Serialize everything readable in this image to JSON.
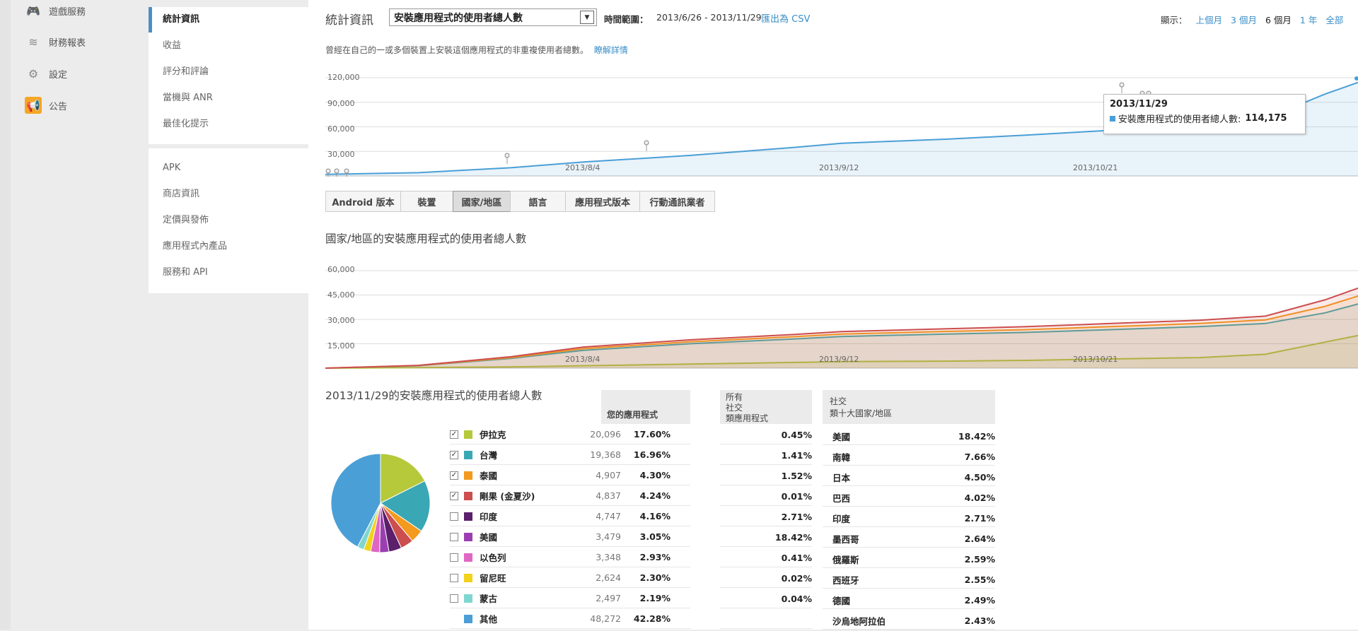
{
  "left_nav": {
    "items": [
      {
        "label": "遊戲服務",
        "icon": "gamepad-icon"
      },
      {
        "label": "財務報表",
        "icon": "coins-icon"
      },
      {
        "label": "設定",
        "icon": "gear-icon"
      },
      {
        "label": "公告",
        "icon": "megaphone-icon"
      }
    ]
  },
  "sub_nav": {
    "group1": [
      "統計資訊",
      "收益",
      "評分和評論",
      "當機與 ANR",
      "最佳化提示"
    ],
    "group2": [
      "APK",
      "商店資訊",
      "定價與發佈",
      "應用程式內產品",
      "服務和 API"
    ]
  },
  "header": {
    "section": "統計資訊",
    "metric_select": "安裝應用程式的使用者總人數",
    "range_label": "時間範圍：",
    "range_value": "2013/6/26 - 2013/11/29",
    "export": "匯出為 CSV",
    "show_label": "顯示：",
    "periods": [
      "上個月",
      "3 個月",
      "6 個月",
      "1 年",
      "全部"
    ],
    "active_period": "6 個月",
    "description": "曾經在自己的一或多個裝置上安裝這個應用程式的非重複使用者總數。",
    "learn_more": "瞭解詳情"
  },
  "colors": {
    "accent": "#3a8ec8",
    "series_total": "#4a9fd6",
    "iraq": "#b5c93a",
    "taiwan": "#3aa7b5",
    "thailand": "#f39a1f",
    "congo": "#cc4e4e",
    "india": "#5b1f6b",
    "usa": "#9b3fb0",
    "israel": "#e066c4",
    "reunion": "#f2d21a",
    "mongolia": "#7fd6d0",
    "other": "#4a9fd6"
  },
  "chart_data": [
    {
      "type": "area",
      "title": "",
      "y_ticks": [
        "120,000",
        "90,000",
        "60,000",
        "30,000"
      ],
      "x_ticks": [
        "2013/8/4",
        "2013/9/12",
        "2013/10/21"
      ],
      "ylim": [
        0,
        120000
      ],
      "series": [
        {
          "name": "安裝應用程式的使用者總人數",
          "x": [
            "2013/6/26",
            "2013/7/10",
            "2013/7/24",
            "2013/8/4",
            "2013/8/20",
            "2013/9/5",
            "2013/9/12",
            "2013/9/28",
            "2013/10/10",
            "2013/10/21",
            "2013/11/5",
            "2013/11/15",
            "2013/11/24",
            "2013/11/29"
          ],
          "values": [
            2000,
            4000,
            10000,
            17000,
            25000,
            35000,
            40000,
            45000,
            50000,
            55000,
            62000,
            70000,
            100000,
            114175
          ]
        }
      ],
      "tooltip": {
        "date": "2013/11/29",
        "label": "安裝應用程式的使用者總人數:",
        "value": "114,175"
      }
    },
    {
      "type": "area",
      "title": "國家/地區的安裝應用程式的使用者總人數",
      "y_ticks": [
        "60,000",
        "45,000",
        "30,000",
        "15,000"
      ],
      "x_ticks": [
        "2013/8/4",
        "2013/9/12",
        "2013/10/21"
      ],
      "ylim": [
        0,
        60000
      ],
      "x": [
        "2013/6/26",
        "2013/7/10",
        "2013/7/24",
        "2013/8/4",
        "2013/8/20",
        "2013/9/5",
        "2013/9/12",
        "2013/9/28",
        "2013/10/10",
        "2013/10/21",
        "2013/11/5",
        "2013/11/15",
        "2013/11/24",
        "2013/11/29"
      ],
      "series": [
        {
          "name": "伊拉克",
          "values": [
            0,
            300,
            800,
            1500,
            2500,
            3500,
            4000,
            4300,
            4800,
            5500,
            6500,
            8500,
            16000,
            20096
          ]
        },
        {
          "name": "台灣",
          "values": [
            0,
            1500,
            6000,
            11000,
            15000,
            18000,
            19500,
            21000,
            22000,
            23500,
            25500,
            27500,
            34000,
            39464
          ]
        },
        {
          "name": "泰國",
          "values": [
            0,
            1600,
            6500,
            12000,
            16200,
            19400,
            21000,
            22600,
            23700,
            25300,
            27500,
            29700,
            38000,
            44371
          ]
        },
        {
          "name": "剛果 (金夏沙)",
          "values": [
            0,
            1700,
            7000,
            13000,
            17400,
            20800,
            22500,
            24200,
            25500,
            27200,
            29500,
            32000,
            42000,
            49208
          ]
        }
      ]
    },
    {
      "type": "pie",
      "title": "2013/11/29的安裝應用程式的使用者總人數",
      "categories": [
        "伊拉克",
        "台灣",
        "泰國",
        "剛果 (金夏沙)",
        "印度",
        "美國",
        "以色列",
        "留尼旺",
        "蒙古",
        "其他"
      ],
      "values": [
        17.6,
        16.96,
        4.3,
        4.24,
        4.16,
        3.05,
        2.93,
        2.3,
        2.19,
        42.28
      ]
    }
  ],
  "table": {
    "col_app": "您的應用程式",
    "col_all_line1": "所有",
    "col_all_line2": "社交",
    "col_all_line3": "類應用程式",
    "col_top_line1": "社交",
    "col_top_line2": "類十大國家/地區",
    "rows": [
      {
        "name": "伊拉克",
        "count": "20,096",
        "pct": "17.60%",
        "all": "0.45%",
        "checked": true,
        "color": "#b5c93a"
      },
      {
        "name": "台灣",
        "count": "19,368",
        "pct": "16.96%",
        "all": "1.41%",
        "checked": true,
        "color": "#3aa7b5"
      },
      {
        "name": "泰國",
        "count": "4,907",
        "pct": "4.30%",
        "all": "1.52%",
        "checked": true,
        "color": "#f39a1f"
      },
      {
        "name": "剛果 (金夏沙)",
        "count": "4,837",
        "pct": "4.24%",
        "all": "0.01%",
        "checked": true,
        "color": "#cc4e4e"
      },
      {
        "name": "印度",
        "count": "4,747",
        "pct": "4.16%",
        "all": "2.71%",
        "checked": false,
        "color": "#5b1f6b"
      },
      {
        "name": "美國",
        "count": "3,479",
        "pct": "3.05%",
        "all": "18.42%",
        "checked": false,
        "color": "#9b3fb0"
      },
      {
        "name": "以色列",
        "count": "3,348",
        "pct": "2.93%",
        "all": "0.41%",
        "checked": false,
        "color": "#e066c4"
      },
      {
        "name": "留尼旺",
        "count": "2,624",
        "pct": "2.30%",
        "all": "0.02%",
        "checked": false,
        "color": "#f2d21a"
      },
      {
        "name": "蒙古",
        "count": "2,497",
        "pct": "2.19%",
        "all": "0.04%",
        "checked": false,
        "color": "#7fd6d0"
      },
      {
        "name": "其他",
        "count": "48,272",
        "pct": "42.28%",
        "all": "",
        "checked": null,
        "color": "#4a9fd6"
      }
    ],
    "top10": [
      {
        "name": "美國",
        "pct": "18.42%"
      },
      {
        "name": "南韓",
        "pct": "7.66%"
      },
      {
        "name": "日本",
        "pct": "4.50%"
      },
      {
        "name": "巴西",
        "pct": "4.02%"
      },
      {
        "name": "印度",
        "pct": "2.71%"
      },
      {
        "name": "墨西哥",
        "pct": "2.64%"
      },
      {
        "name": "俄羅斯",
        "pct": "2.59%"
      },
      {
        "name": "西班牙",
        "pct": "2.55%"
      },
      {
        "name": "德國",
        "pct": "2.49%"
      },
      {
        "name": "沙烏地阿拉伯",
        "pct": "2.43%"
      }
    ]
  },
  "tabs": [
    "Android 版本",
    "裝置",
    "國家/地區",
    "語言",
    "應用程式版本",
    "行動通訊業者"
  ],
  "active_tab": "國家/地區"
}
